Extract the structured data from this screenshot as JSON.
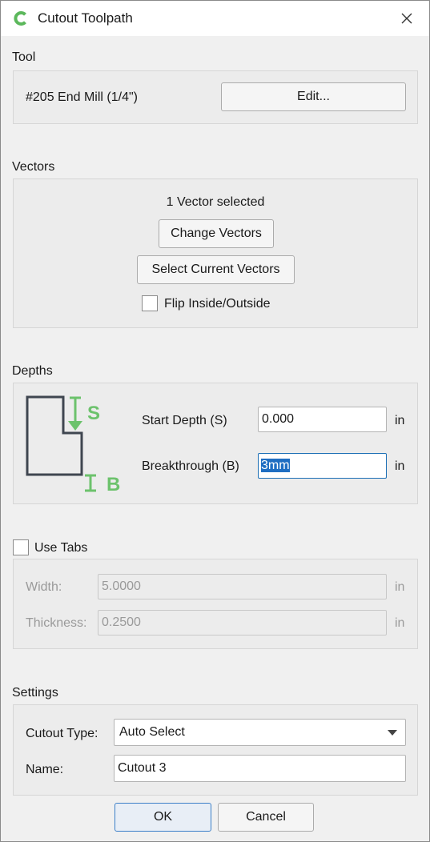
{
  "window": {
    "title": "Cutout Toolpath",
    "app_icon": "c-logo-icon",
    "accent_color": "#5cb85c"
  },
  "tool": {
    "section_label": "Tool",
    "tool_name": "#205 End Mill (1/4\")",
    "edit_label": "Edit..."
  },
  "vectors": {
    "section_label": "Vectors",
    "status": "1 Vector selected",
    "change_label": "Change Vectors",
    "select_current_label": "Select Current Vectors",
    "flip_label": "Flip Inside/Outside",
    "flip_checked": false
  },
  "depths": {
    "section_label": "Depths",
    "diagram_start_letter": "S",
    "diagram_break_letter": "B",
    "start_label": "Start Depth (S)",
    "start_value": "0.000",
    "start_unit": "in",
    "breakthrough_label": "Breakthrough (B)",
    "breakthrough_value": "3mm",
    "breakthrough_unit": "in"
  },
  "tabs": {
    "use_tabs_label": "Use Tabs",
    "use_tabs_checked": false,
    "width_label": "Width:",
    "width_value": "5.0000",
    "width_unit": "in",
    "thickness_label": "Thickness:",
    "thickness_value": "0.2500",
    "thickness_unit": "in"
  },
  "settings": {
    "section_label": "Settings",
    "cutout_type_label": "Cutout Type:",
    "cutout_type_value": "Auto Select",
    "name_label": "Name:",
    "name_value": "Cutout 3"
  },
  "footer": {
    "ok_label": "OK",
    "cancel_label": "Cancel"
  }
}
